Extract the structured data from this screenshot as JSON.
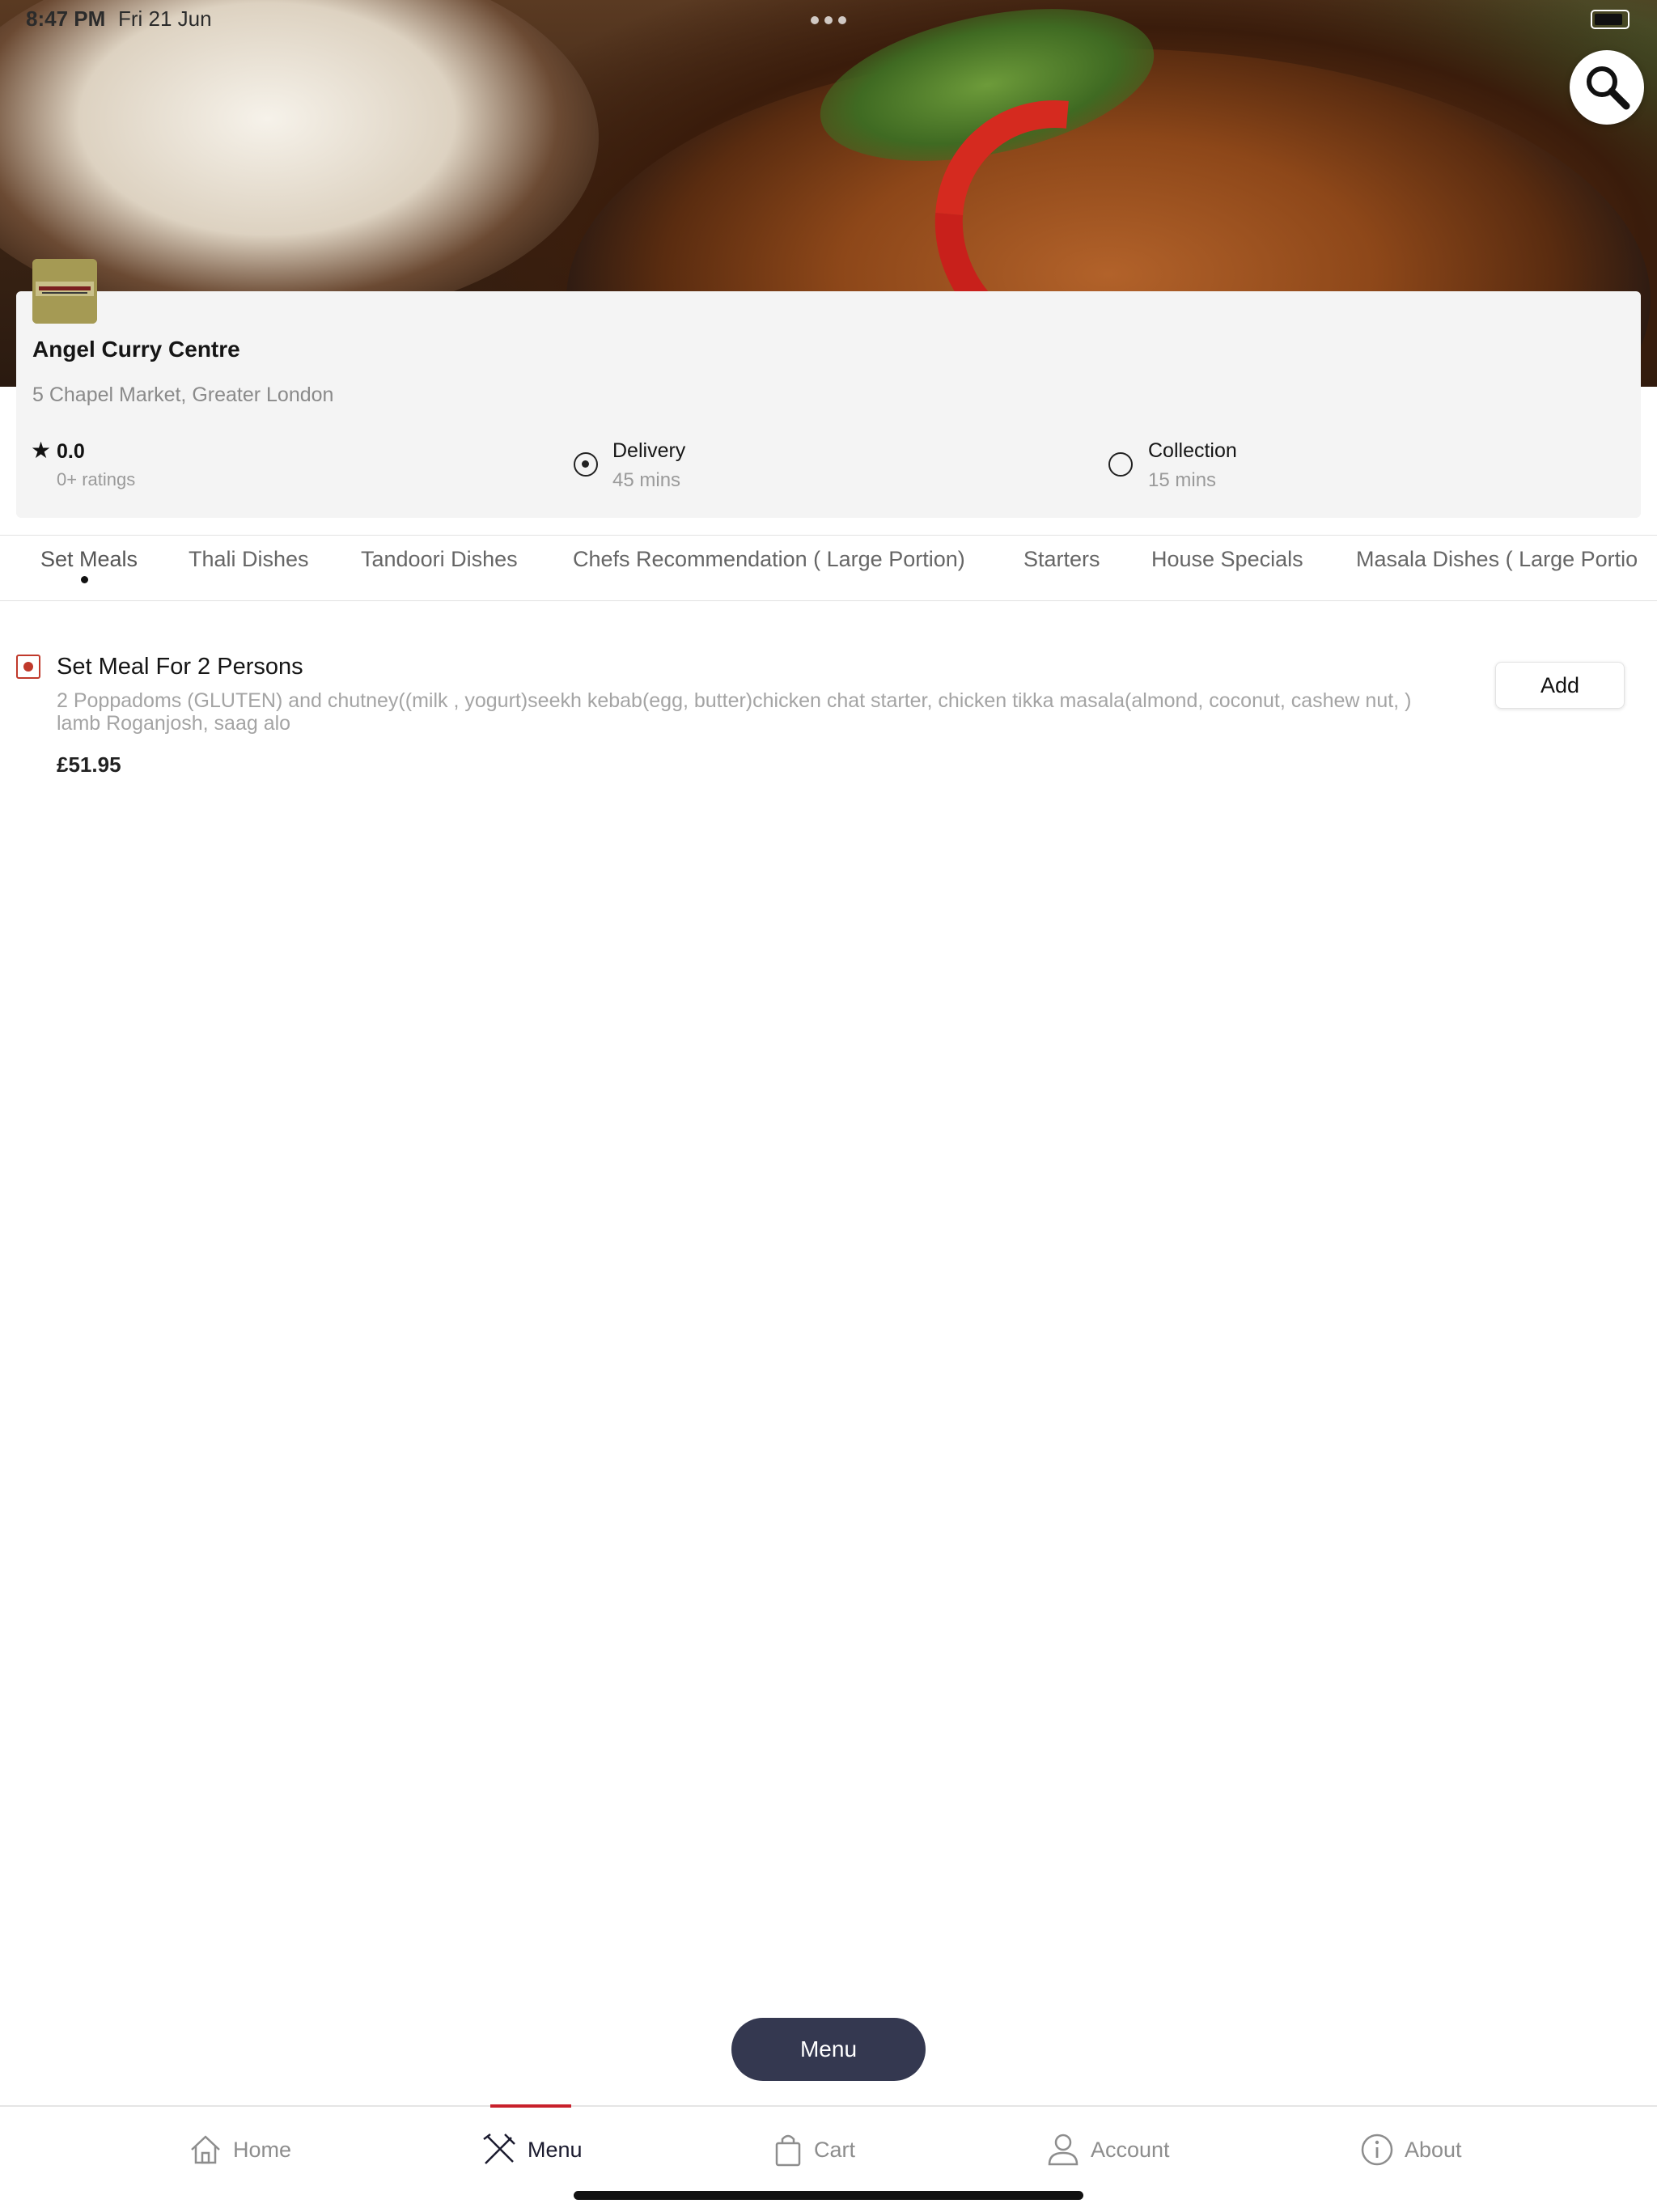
{
  "status_bar": {
    "time": "8:47 PM",
    "date": "Fri 21 Jun"
  },
  "restaurant": {
    "name": "Angel Curry Centre",
    "address": "5 Chapel Market, Greater London",
    "rating": "0.0",
    "ratings_count": "0+ ratings"
  },
  "order_options": {
    "delivery": {
      "label": "Delivery",
      "time": "45 mins",
      "selected": true
    },
    "collection": {
      "label": "Collection",
      "time": "15 mins",
      "selected": false
    }
  },
  "categories": [
    "Set Meals",
    "Thali Dishes",
    "Tandoori Dishes",
    "Chefs Recommendation ( Large Portion)",
    "Starters",
    "House Specials",
    "Masala Dishes ( Large Portio"
  ],
  "active_category": "Set Meals",
  "items": [
    {
      "title": "Set Meal For 2 Persons",
      "description": "2 Poppadoms (GLUTEN) and chutney((milk , yogurt)seekh kebab(egg, butter)chicken chat starter, chicken tikka masala(almond, coconut, cashew nut, ) lamb Roganjosh, saag alo",
      "price": "£51.95",
      "add_label": "Add"
    }
  ],
  "menu_button": "Menu",
  "bottom_nav": [
    {
      "label": "Home",
      "icon": "home-icon"
    },
    {
      "label": "Menu",
      "icon": "menu-cutlery-icon",
      "active": true
    },
    {
      "label": "Cart",
      "icon": "shopping-bag-icon"
    },
    {
      "label": "Account",
      "icon": "user-icon"
    },
    {
      "label": "About",
      "icon": "info-icon"
    }
  ],
  "colors": {
    "accent": "#c8202b",
    "pill": "#343850",
    "card_bg": "#f4f4f4"
  }
}
